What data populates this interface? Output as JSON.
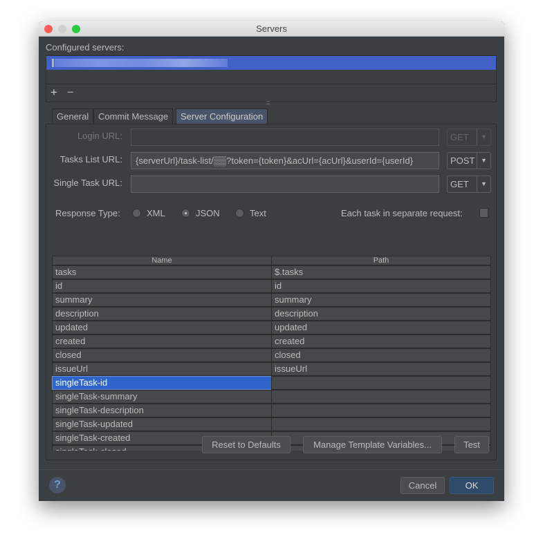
{
  "window": {
    "title": "Servers"
  },
  "servers": {
    "label": "Configured servers:",
    "items": [
      "[redacted server]"
    ],
    "add": "+",
    "remove": "−"
  },
  "tabs": [
    {
      "label": "General"
    },
    {
      "label": "Commit Message"
    },
    {
      "label": "Server Configuration",
      "active": true
    }
  ],
  "config": {
    "login_url": {
      "label": "Login URL:",
      "value": "",
      "method": "GET",
      "enabled": false
    },
    "tasks_list_url": {
      "label": "Tasks List URL:",
      "value": "{serverUrl}/task-list/▒▒?token={token}&acUrl={acUrl}&userId={userId}",
      "method": "POST"
    },
    "single_task_url": {
      "label": "Single Task URL:",
      "value": "",
      "method": "GET"
    },
    "response_type": {
      "label": "Response Type:",
      "options": [
        "XML",
        "JSON",
        "Text"
      ],
      "selected": "JSON"
    },
    "separate_request": {
      "label": "Each task in separate request:",
      "checked": false
    }
  },
  "table": {
    "columns": [
      "Name",
      "Path"
    ],
    "rows": [
      [
        "tasks",
        "$.tasks"
      ],
      [
        "id",
        "id"
      ],
      [
        "summary",
        "summary"
      ],
      [
        "description",
        "description"
      ],
      [
        "updated",
        "updated"
      ],
      [
        "created",
        "created"
      ],
      [
        "closed",
        "closed"
      ],
      [
        "issueUrl",
        "issueUrl"
      ],
      [
        "singleTask-id",
        ""
      ],
      [
        "singleTask-summary",
        ""
      ],
      [
        "singleTask-description",
        ""
      ],
      [
        "singleTask-updated",
        ""
      ],
      [
        "singleTask-created",
        ""
      ],
      [
        "singleTask-closed",
        ""
      ]
    ],
    "selected_row": 8
  },
  "buttons": {
    "reset": "Reset to Defaults",
    "manage": "Manage Template Variables...",
    "test": "Test",
    "cancel": "Cancel",
    "ok": "OK",
    "help": "?"
  },
  "colors": {
    "selection": "#4160c8",
    "background": "#3c3f41",
    "ok": "#2f4a6b"
  }
}
